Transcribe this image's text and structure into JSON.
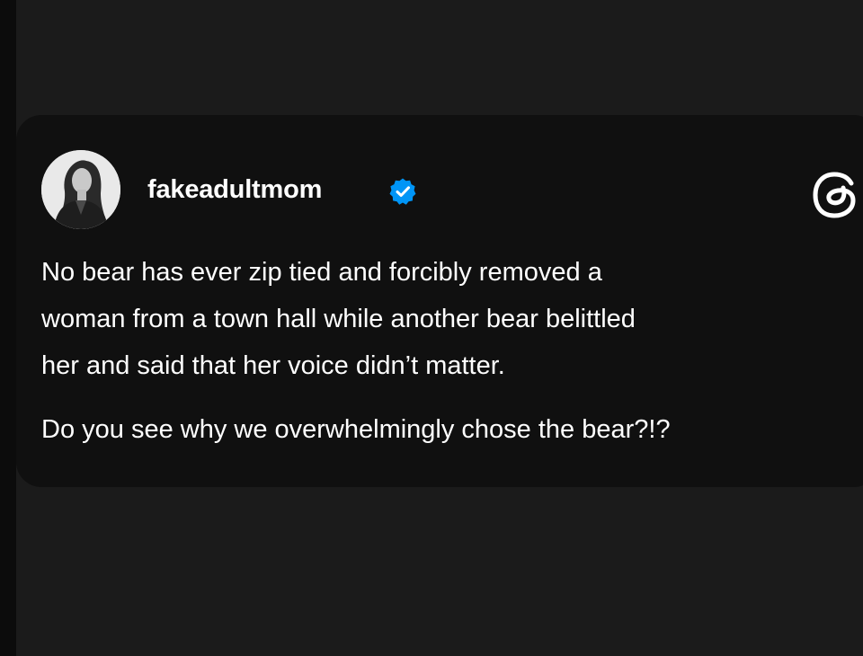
{
  "post": {
    "author": {
      "username": "fakeadultmom",
      "verified": true,
      "avatar_icon": "profile-photo"
    },
    "platform_icon": "threads-logo-icon",
    "body_lines": [
      "No bear has ever zip tied and forcibly removed a",
      "woman from a town hall while another bear belittled",
      "her and said that her voice didn’t matter."
    ],
    "question": "Do you see why we overwhelmingly chose the bear?!?"
  },
  "colors": {
    "page_background": "#1b1b1b",
    "card_background": "#101010",
    "text": "#ffffff",
    "verified_badge": "#0095f6"
  }
}
